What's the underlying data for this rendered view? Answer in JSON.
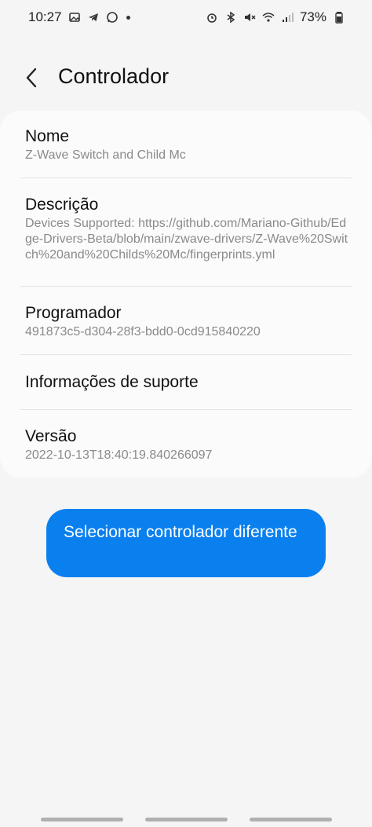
{
  "status": {
    "time": "10:27",
    "battery": "73%"
  },
  "header": {
    "title": "Controlador"
  },
  "details": [
    {
      "title": "Nome",
      "value": "Z-Wave Switch and Child Mc"
    },
    {
      "title": "Descrição",
      "value": "Devices Supported: https://github.com/Mariano-Github/Edge-Drivers-Beta/blob/main/zwave-drivers/Z-Wave%20Switch%20and%20Childs%20Mc/fingerprints.yml"
    },
    {
      "title": "Programador",
      "value": "491873c5-d304-28f3-bdd0-0cd915840220"
    },
    {
      "title": "Informações de suporte"
    },
    {
      "title": "Versão",
      "value": "2022-10-13T18:40:19.840266097"
    }
  ],
  "actions": {
    "select_driver_label": "Selecionar controlador diferente"
  }
}
